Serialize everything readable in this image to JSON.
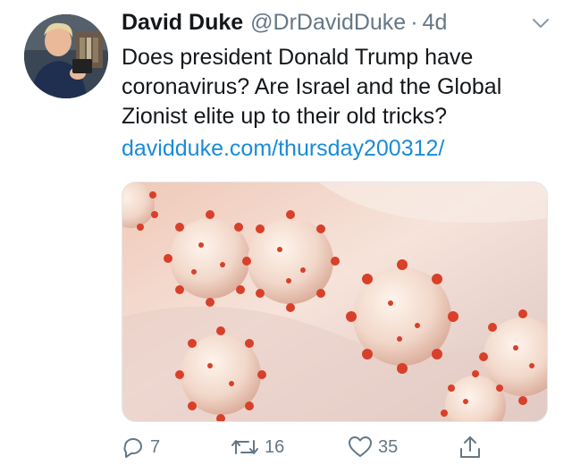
{
  "tweet": {
    "author_name": "David Duke",
    "author_handle": "@DrDavidDuke",
    "separator": "·",
    "time": "4d",
    "text_lines": [
      "Does president Donald Trump have",
      "coronavirus? Are Israel and the Global",
      "Zionist elite up to their old tricks?"
    ],
    "link": "davidduke.com/thursday200312/"
  },
  "media": {
    "description_icon": "virus-image"
  },
  "actions": {
    "reply_count": "7",
    "retweet_count": "16",
    "like_count": "35"
  },
  "colors": {
    "link": "#1b8bd6",
    "secondary_text": "#657786",
    "virus_red": "#d8402a"
  }
}
